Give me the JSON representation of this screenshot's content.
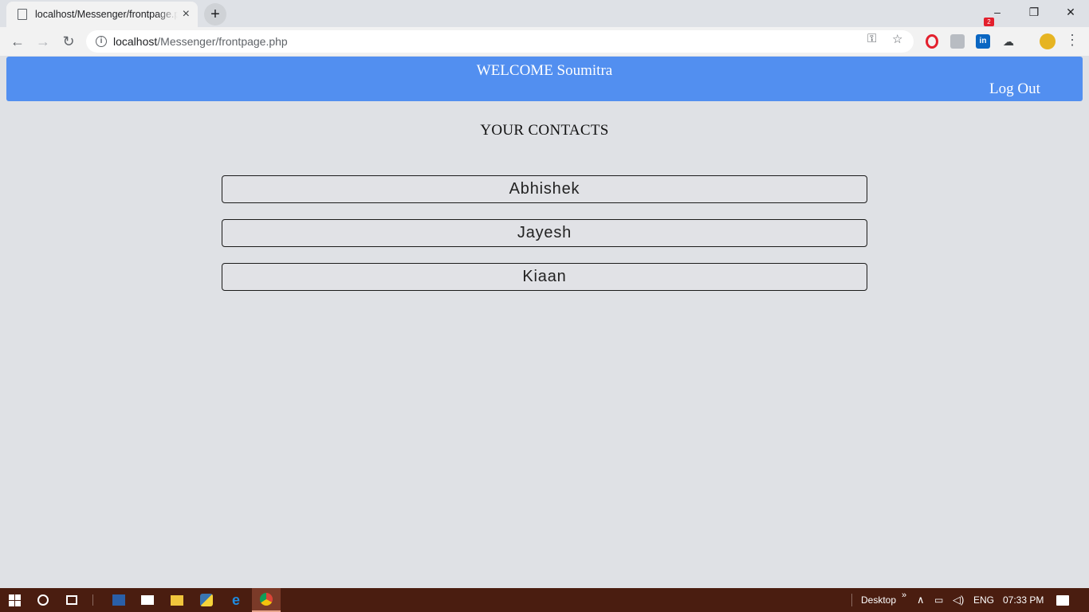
{
  "browser": {
    "tab_title": "localhost/Messenger/frontpage.php",
    "tab_close": "×",
    "new_tab": "+",
    "url_host": "localhost",
    "url_path": "/Messenger/frontpage.php",
    "window_controls": {
      "minimize": "–",
      "restore": "❐",
      "close": "✕"
    },
    "nav": {
      "back": "←",
      "forward": "→",
      "reload": "↻"
    },
    "extension_badge": "2"
  },
  "header": {
    "welcome": "WELCOME Soumitra",
    "logout": "Log Out",
    "color": "#528ff0"
  },
  "contacts": {
    "heading": "YOUR CONTACTS",
    "items": [
      "Abhishek",
      "Jayesh",
      "Kiaan"
    ]
  },
  "taskbar": {
    "desktop_label": "Desktop",
    "desktop_chevron": "»",
    "language": "ENG",
    "time": "07:33 PM"
  }
}
